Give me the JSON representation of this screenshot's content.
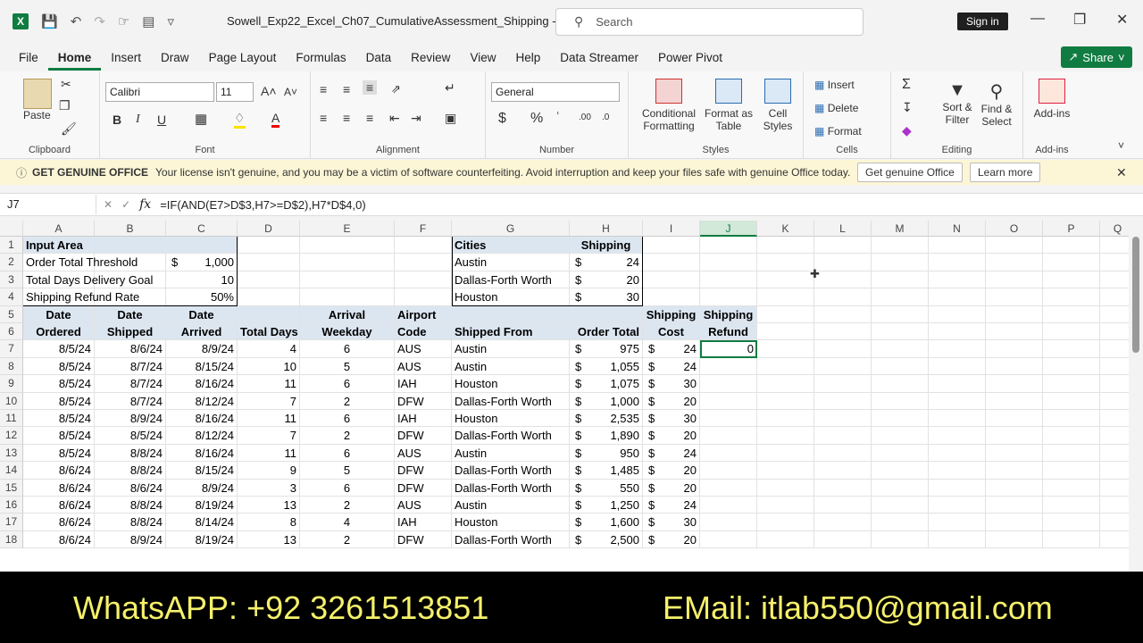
{
  "title_bar": {
    "doc_title": "Sowell_Exp22_Excel_Ch07_CumulativeAssessment_Shipping  -...",
    "search_placeholder": "Search",
    "sign_in": "Sign in"
  },
  "menu": {
    "tabs": [
      "File",
      "Home",
      "Insert",
      "Draw",
      "Page Layout",
      "Formulas",
      "Data",
      "Review",
      "View",
      "Help",
      "Data Streamer",
      "Power Pivot"
    ],
    "active": "Home",
    "share": "Share"
  },
  "ribbon": {
    "clipboard": {
      "label": "Clipboard",
      "paste": "Paste"
    },
    "font": {
      "label": "Font",
      "family": "Calibri",
      "size": "11"
    },
    "alignment": {
      "label": "Alignment"
    },
    "number": {
      "label": "Number",
      "format": "General",
      "currency": "$",
      "percent": "%"
    },
    "styles": {
      "label": "Styles",
      "conditional": "Conditional",
      "formatting": "Formatting",
      "format_as": "Format as",
      "table": "Table",
      "cell": "Cell",
      "styles": "Styles"
    },
    "cells": {
      "label": "Cells",
      "insert": "Insert",
      "delete": "Delete",
      "format": "Format"
    },
    "editing": {
      "label": "Editing",
      "sort": "Sort &",
      "filter": "Filter",
      "find": "Find &",
      "select": "Select"
    },
    "addins": {
      "label": "Add-ins",
      "addins": "Add-ins"
    }
  },
  "message_bar": {
    "title": "GET GENUINE OFFICE",
    "text": "Your license isn't genuine, and you may be a victim of software counterfeiting. Avoid interruption and keep your files safe with genuine Office today.",
    "button1": "Get genuine Office",
    "button2": "Learn more"
  },
  "formula_bar": {
    "name_box": "J7",
    "formula": "=IF(AND(E7>D$3,H7>=D$2),H7*D$4,0)"
  },
  "columns": [
    "A",
    "B",
    "C",
    "D",
    "E",
    "F",
    "G",
    "H",
    "I",
    "J",
    "K",
    "L",
    "M",
    "N",
    "O",
    "P",
    "Q"
  ],
  "rows": [
    "1",
    "2",
    "3",
    "4",
    "5",
    "6",
    "7",
    "8",
    "9",
    "10",
    "11",
    "12",
    "13",
    "14",
    "15",
    "16",
    "17",
    "18"
  ],
  "input_area": {
    "title": "Input Area",
    "rows": [
      {
        "label": "Order Total Threshold",
        "value": "1,000",
        "dollar": "$"
      },
      {
        "label": "Total Days Delivery Goal",
        "value": "10",
        "dollar": ""
      },
      {
        "label": "Shipping Refund Rate",
        "value": "50%",
        "dollar": ""
      }
    ]
  },
  "cities": {
    "header_city": "Cities",
    "header_ship": "Shipping",
    "rows": [
      {
        "city": "Austin",
        "ship": "24"
      },
      {
        "city": "Dallas-Forth Worth",
        "ship": "20"
      },
      {
        "city": "Houston",
        "ship": "30"
      }
    ],
    "dollar": "$"
  },
  "table_headers": {
    "a1": "Date",
    "a2": "Ordered",
    "b1": "Date",
    "b2": "Shipped",
    "c1": "Date",
    "c2": "Arrived",
    "d2": "Total Days",
    "e1": "Arrival",
    "e2": "Weekday",
    "f1": "Airport",
    "f2": "Code",
    "g2": "Shipped From",
    "h2": "Order Total",
    "i1": "Shipping",
    "i2": "Cost",
    "j1": "Shipping",
    "j2": "Refund"
  },
  "data": [
    [
      "8/5/24",
      "8/6/24",
      "8/9/24",
      "4",
      "6",
      "AUS",
      "Austin",
      "975",
      "24",
      "0"
    ],
    [
      "8/5/24",
      "8/7/24",
      "8/15/24",
      "10",
      "5",
      "AUS",
      "Austin",
      "1,055",
      "24",
      ""
    ],
    [
      "8/5/24",
      "8/7/24",
      "8/16/24",
      "11",
      "6",
      "IAH",
      "Houston",
      "1,075",
      "30",
      ""
    ],
    [
      "8/5/24",
      "8/7/24",
      "8/12/24",
      "7",
      "2",
      "DFW",
      "Dallas-Forth Worth",
      "1,000",
      "20",
      ""
    ],
    [
      "8/5/24",
      "8/9/24",
      "8/16/24",
      "11",
      "6",
      "IAH",
      "Houston",
      "2,535",
      "30",
      ""
    ],
    [
      "8/5/24",
      "8/5/24",
      "8/12/24",
      "7",
      "2",
      "DFW",
      "Dallas-Forth Worth",
      "1,890",
      "20",
      ""
    ],
    [
      "8/5/24",
      "8/8/24",
      "8/16/24",
      "11",
      "6",
      "AUS",
      "Austin",
      "950",
      "24",
      ""
    ],
    [
      "8/6/24",
      "8/8/24",
      "8/15/24",
      "9",
      "5",
      "DFW",
      "Dallas-Forth Worth",
      "1,485",
      "20",
      ""
    ],
    [
      "8/6/24",
      "8/6/24",
      "8/9/24",
      "3",
      "6",
      "DFW",
      "Dallas-Forth Worth",
      "550",
      "20",
      ""
    ],
    [
      "8/6/24",
      "8/8/24",
      "8/19/24",
      "13",
      "2",
      "AUS",
      "Austin",
      "1,250",
      "24",
      ""
    ],
    [
      "8/6/24",
      "8/8/24",
      "8/14/24",
      "8",
      "4",
      "IAH",
      "Houston",
      "1,600",
      "30",
      ""
    ],
    [
      "8/6/24",
      "8/9/24",
      "8/19/24",
      "13",
      "2",
      "DFW",
      "Dallas-Forth Worth",
      "2,500",
      "20",
      ""
    ]
  ],
  "dollar_sign": "$",
  "banner": {
    "whatsapp": "WhatsAPP: +92 3261513851",
    "email": "EMail: itlab550@gmail.com"
  }
}
